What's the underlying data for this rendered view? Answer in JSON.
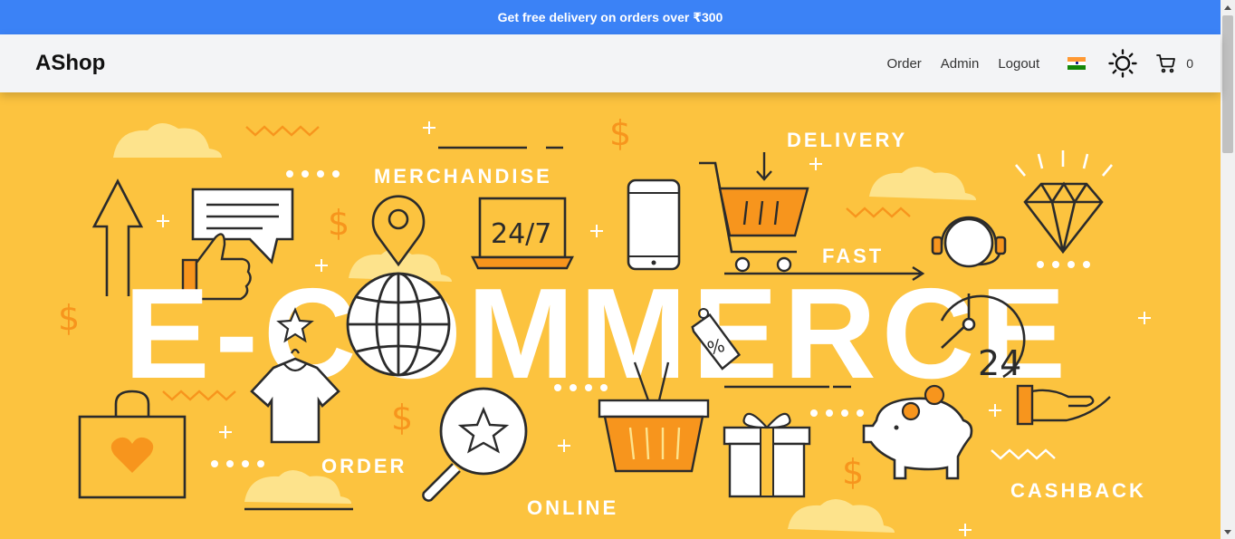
{
  "promo": {
    "text": "Get free delivery on orders over ₹300"
  },
  "brand": {
    "name": "AShop"
  },
  "nav": {
    "links": [
      {
        "label": "Order"
      },
      {
        "label": "Admin"
      },
      {
        "label": "Logout"
      }
    ],
    "flag_icon": "india-flag-icon",
    "theme_icon": "sun-icon",
    "cart_icon": "cart-icon",
    "cart_count": "0"
  },
  "hero": {
    "headline": "E-COMMERCE",
    "labels": {
      "merchandise": "MERCHANDISE",
      "delivery": "DELIVERY",
      "fast": "FAST",
      "order": "ORDER",
      "online": "ONLINE",
      "cashback": "CASHBACK",
      "hours_24_7": "24/7",
      "hours_24": "24",
      "percent": "%"
    }
  },
  "colors": {
    "promo_bg": "#3b82f6",
    "navbar_bg": "#f3f4f6",
    "hero_bg": "#fcc33f",
    "hero_accent": "#f7951d",
    "cloud": "#fde38c",
    "ink": "#2b2b2b"
  }
}
